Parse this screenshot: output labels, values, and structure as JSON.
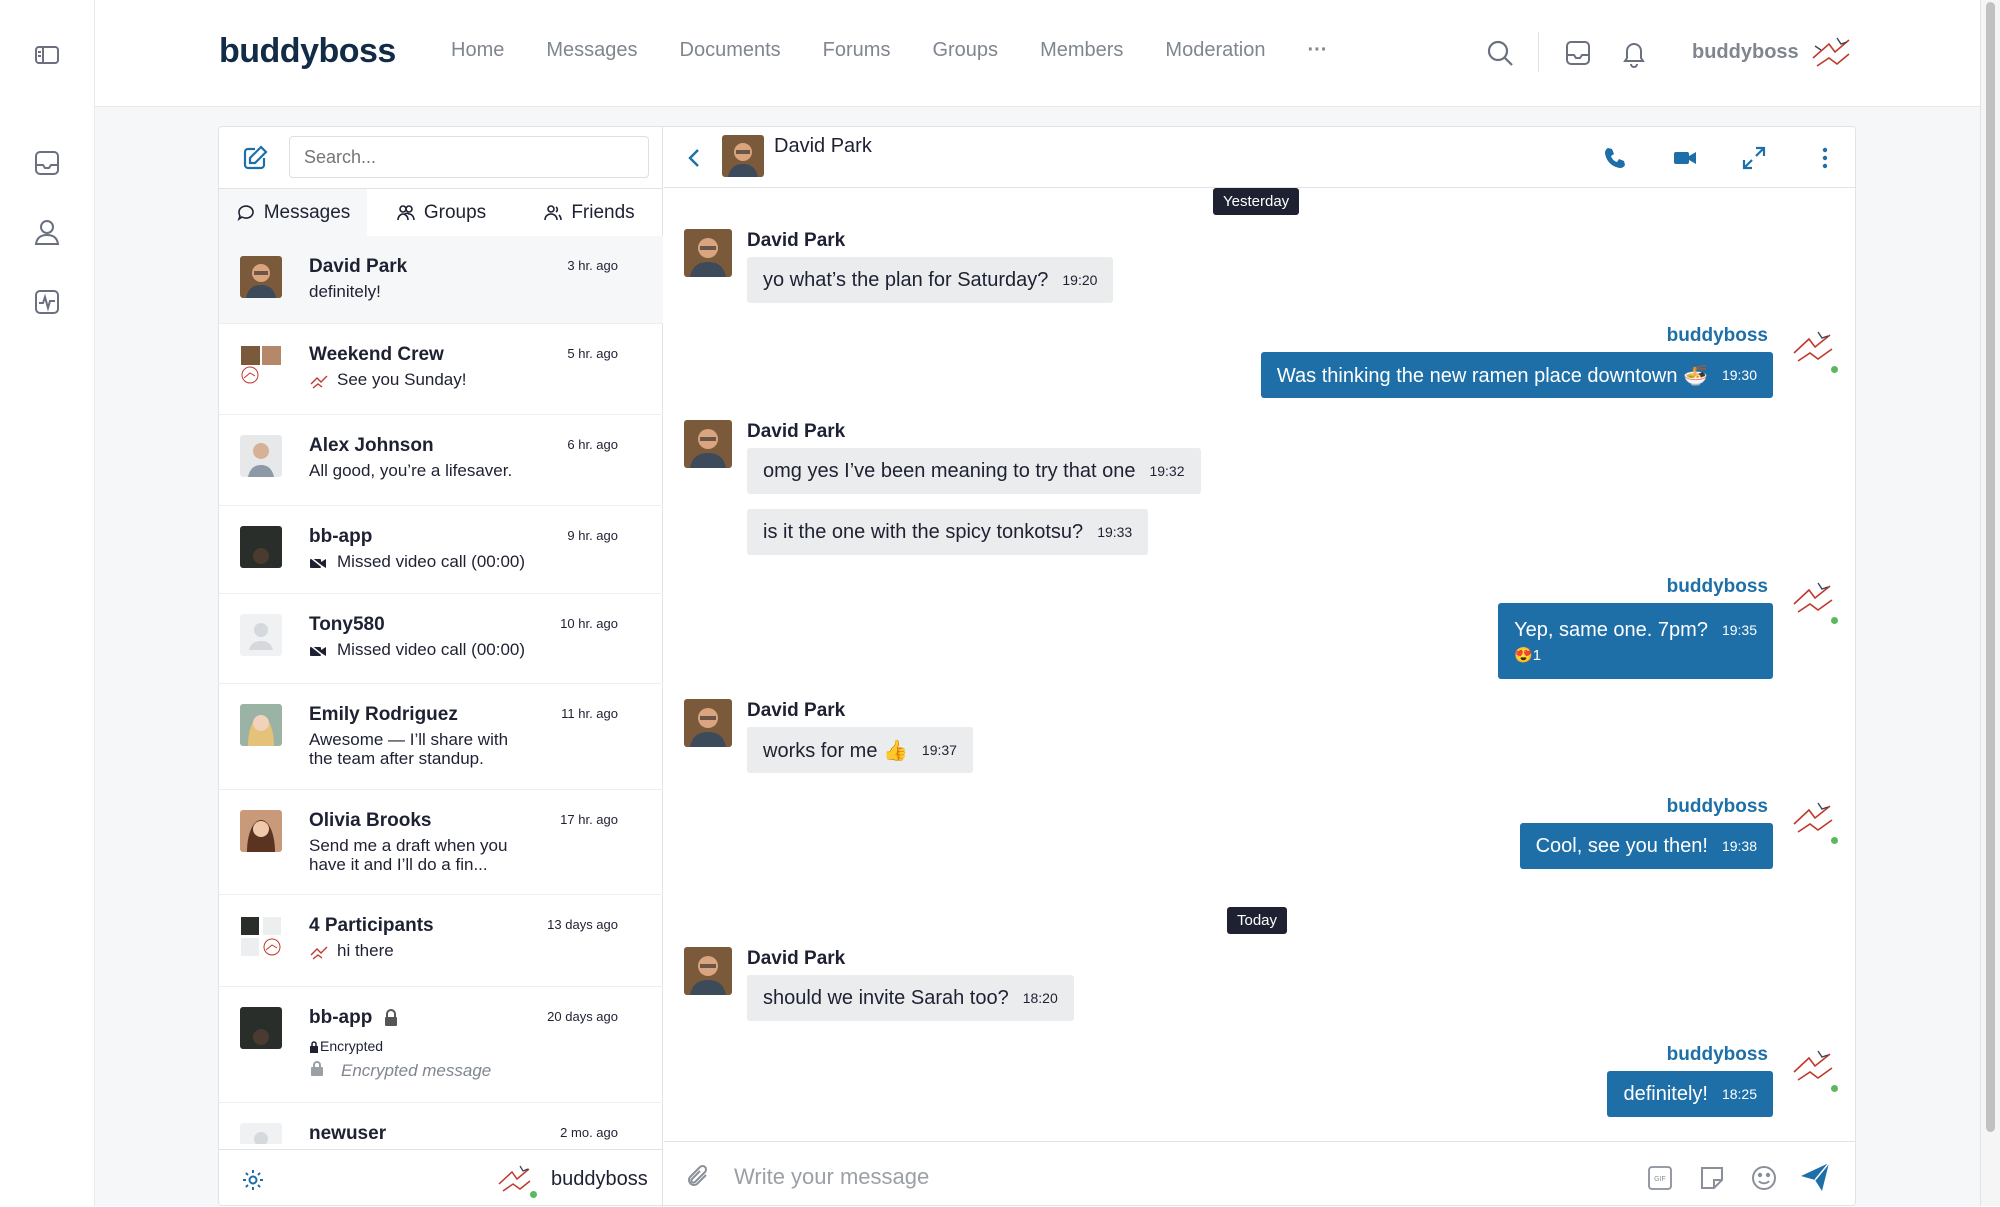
{
  "brand": "buddyboss",
  "nav": [
    "Home",
    "Messages",
    "Documents",
    "Forums",
    "Groups",
    "Members",
    "Moderation",
    "···"
  ],
  "user": {
    "name": "buddyboss"
  },
  "search": {
    "placeholder": "Search..."
  },
  "tabs": [
    "Messages",
    "Groups",
    "Friends"
  ],
  "threads": [
    {
      "name": "David Park",
      "time": "3 hr. ago",
      "msg": "definitely!",
      "av": "david"
    },
    {
      "name": "Weekend Crew",
      "time": "5 hr. ago",
      "msg": "See you Sunday!",
      "av": "group",
      "icon": "sketch-avatar-icon"
    },
    {
      "name": "Alex Johnson",
      "time": "6 hr. ago",
      "msg": "All good, you’re a lifesaver.",
      "av": "alex"
    },
    {
      "name": "bb-app",
      "time": "9 hr. ago",
      "msg": "Missed video call (00:00)",
      "av": "dark",
      "icon": "video-off-icon"
    },
    {
      "name": "Tony580",
      "time": "10 hr. ago",
      "msg": "Missed video call (00:00)",
      "av": "blank",
      "icon": "video-off-icon"
    },
    {
      "name": "Emily Rodriguez",
      "time": "11 hr. ago",
      "msg": "Awesome — I’ll share with the team after standup.",
      "av": "emily"
    },
    {
      "name": "Olivia Brooks",
      "time": "17 hr. ago",
      "msg": "Send me a draft when you have it and I’ll do a fin...",
      "av": "olivia"
    },
    {
      "name": "4 Participants",
      "time": "13 days ago",
      "msg": "hi there",
      "av": "group2",
      "icon": "sketch-avatar-icon"
    },
    {
      "name": "bb-app",
      "time": "20 days ago",
      "msg": "Encrypted message",
      "av": "dark",
      "encrypted": "Encrypted",
      "lock": true
    },
    {
      "name": "newuser",
      "time": "2 mo. ago",
      "msg": "",
      "av": "blank"
    }
  ],
  "chat": {
    "title": "David Park",
    "composer_placeholder": "Write your message",
    "days": [
      "Yesterday",
      "Today"
    ],
    "messages": [
      {
        "from": "David Park",
        "who": "them",
        "text": "yo what’s the plan for Saturday?",
        "time": "19:20"
      },
      {
        "from": "buddyboss",
        "who": "me",
        "text": "Was thinking the new ramen place downtown 🍜",
        "time": "19:30"
      },
      {
        "from": "David Park",
        "who": "them",
        "text": "omg yes I’ve been meaning to try that one",
        "time": "19:32"
      },
      {
        "from": "",
        "who": "them",
        "text": "is it the one with the spicy tonkotsu?",
        "time": "19:33"
      },
      {
        "from": "buddyboss",
        "who": "me",
        "text": "Yep, same one. 7pm?",
        "time": "19:35",
        "reaction": "😍1"
      },
      {
        "from": "David Park",
        "who": "them",
        "text": "works for me 👍",
        "time": "19:37"
      },
      {
        "from": "buddyboss",
        "who": "me",
        "text": "Cool, see you then!",
        "time": "19:38"
      },
      {
        "from": "David Park",
        "who": "them",
        "text": "should we invite Sarah too?",
        "time": "18:20"
      },
      {
        "from": "buddyboss",
        "who": "me",
        "text": "definitely!",
        "time": "18:25"
      }
    ]
  },
  "colors": {
    "accent": "#1e6fa8",
    "online": "#5cb85c",
    "dark": "#1e2132"
  }
}
